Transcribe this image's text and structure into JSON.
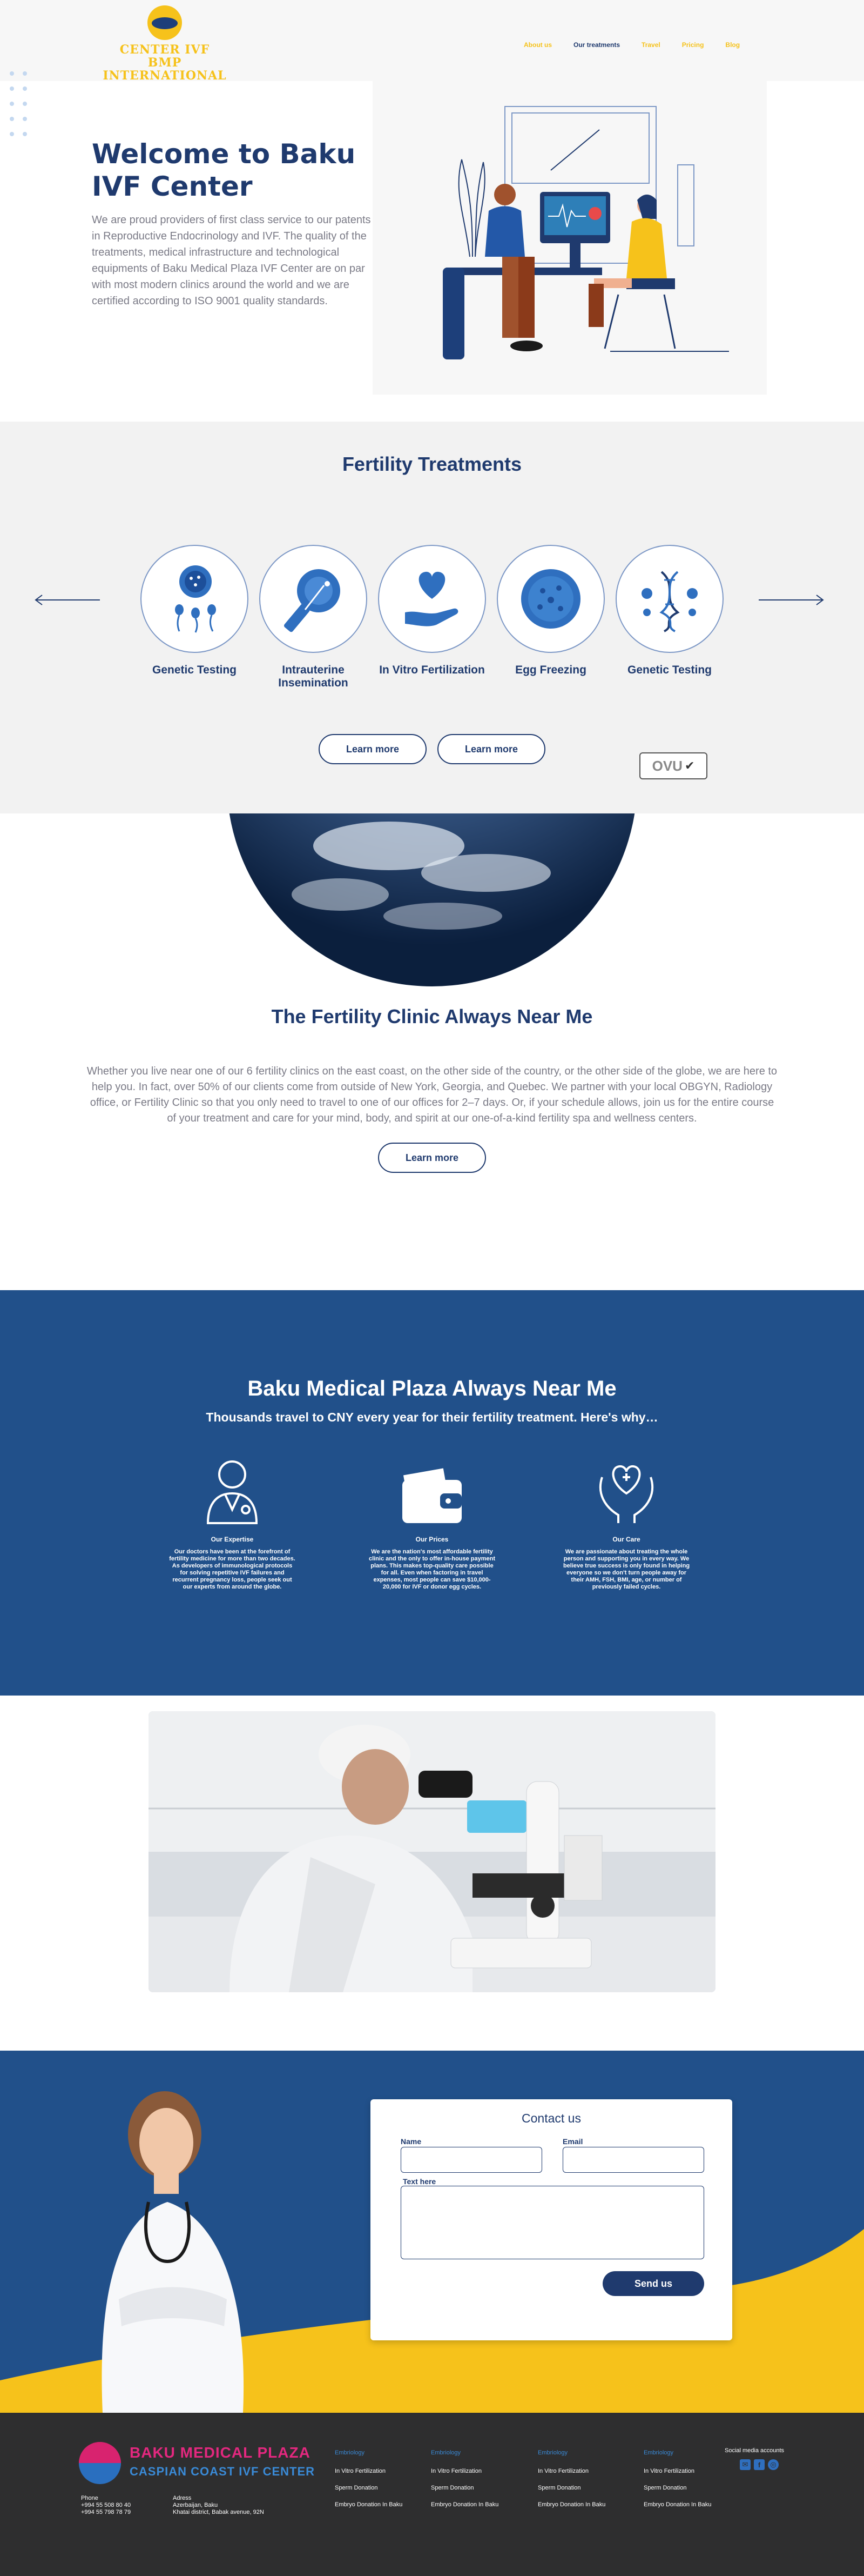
{
  "header": {
    "logo_line1": "CENTER IVF",
    "logo_line2": "BMP INTERNATIONAL",
    "nav": [
      {
        "label": "About us"
      },
      {
        "label": "Our treatments"
      },
      {
        "label": "Travel"
      },
      {
        "label": "Pricing"
      },
      {
        "label": "Blog"
      }
    ]
  },
  "hero": {
    "title": "Welcome to Baku IVF Center",
    "text": "We are proud providers of first class service to our patents in Reproductive Endocrinology and IVF. The quality of the treatments, medical infrastructure and technological equipments of Baku Medical Plaza IVF Center are on par with most modern clinics around the world and we are certified according to ISO 9001 quality standards."
  },
  "treatments": {
    "title": "Fertility Treatments",
    "items": [
      {
        "label": "Genetic Testing",
        "icon": "sperm-egg-icon"
      },
      {
        "label": "Intrauterine Insemination",
        "icon": "insemination-icon"
      },
      {
        "label": "In Vitro Fertilization",
        "icon": "heart-hand-icon"
      },
      {
        "label": "Egg Freezing",
        "icon": "egg-cell-icon"
      },
      {
        "label": "Genetic Testing",
        "icon": "dna-icon"
      }
    ],
    "btn1": "Learn more",
    "btn2": "Learn more",
    "badge": "OVU"
  },
  "clinic": {
    "title": "The Fertility Clinic Always Near Me",
    "text": "Whether you live near one of our 6 fertility clinics on the east coast, on the other side of the country, or the other side of the globe, we are here to help you. In fact, over 50% of our clients come from outside of New York, Georgia, and Quebec. We partner with your local OBGYN, Radiology office, or Fertility Clinic so that you only need to travel to one of our offices for 2–7 days. Or, if your schedule allows, join us for the entire course of your treatment and care for your mind, body, and spirit at our one-of-a-kind fertility spa and wellness centers.",
    "button": "Learn more"
  },
  "plaza": {
    "title": "Baku Medical Plaza Always Near Me",
    "subtitle": "Thousands travel to CNY every year for their fertility treatment. Here's why…",
    "columns": [
      {
        "title": "Our Expertise",
        "text": "Our doctors have been at the forefront of fertility medicine for more than two decades. As developers of immunological protocols for solving repetitive IVF failures and recurrent pregnancy loss, people seek out our experts from around the globe.",
        "icon": "doctor-icon"
      },
      {
        "title": "Our Prices",
        "text": "We are the nation's most affordable fertility clinic and the only to offer in-house payment plans. This makes top-quality care possible for all. Even when factoring in travel expenses, most people can save $10,000-20,000 for IVF or donor egg cycles.",
        "icon": "wallet-icon"
      },
      {
        "title": "Our Care",
        "text": "We are passionate about treating the whole person and supporting you in every way. We believe true success is only found in helping everyone so we don't turn people away for their AMH, FSH, BMI, age, or number of previously failed cycles.",
        "icon": "caring-hands-icon"
      }
    ]
  },
  "contact": {
    "title": "Contact us",
    "name_label": "Name",
    "email_label": "Email",
    "text_label": "Text here",
    "send": "Send us"
  },
  "footer": {
    "brand_title": "BAKU MEDICAL PLAZA",
    "brand_sub": "CASPIAN COAST IVF CENTER",
    "phone_label": "Phone",
    "phone1": "+994 55 508 80 40",
    "phone2": "+994 55 798 78 79",
    "address_label": "Adress",
    "address1": "Azerbaijan, Baku",
    "address2": "Khatai district, Babak avenue, 92N",
    "columns": [
      {
        "head": "Embriology",
        "items": [
          "In Vitro Fertilization",
          "Sperm Donation",
          "Embryo Donation In Baku"
        ]
      },
      {
        "head": "Embriology",
        "items": [
          "In Vitro Fertilization",
          "Sperm Donation",
          "Embryo Donation In Baku"
        ]
      },
      {
        "head": "Embriology",
        "items": [
          "In Vitro Fertilization",
          "Sperm Donation",
          "Embryo Donation In Baku"
        ]
      },
      {
        "head": "Embriology",
        "items": [
          "In Vitro Fertilization",
          "Sperm Donation",
          "Embryo Donation In Baku"
        ]
      }
    ],
    "social_title": "Social media accounts"
  },
  "colors": {
    "navy": "#1f3a6e",
    "brand_blue": "#21508a",
    "yellow": "#f6c21b",
    "footer_bg": "#2e2e2f",
    "pink": "#e3287f"
  }
}
